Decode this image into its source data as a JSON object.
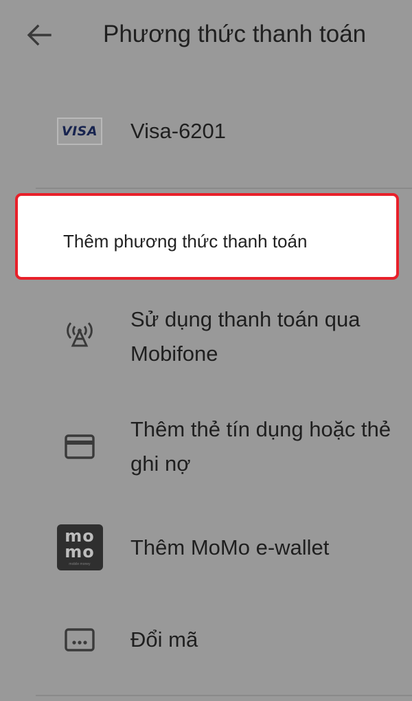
{
  "header": {
    "title": "Phương thức thanh toán",
    "back_icon": "arrow-left-icon"
  },
  "saved_method": {
    "brand_badge": "VISA",
    "label": "Visa-6201",
    "icon": "visa-icon"
  },
  "add_method": {
    "label": "Thêm phương thức thanh toán"
  },
  "options": [
    {
      "icon": "carrier-signal-icon",
      "label": "Sử dụng thanh toán qua Mobifone"
    },
    {
      "icon": "credit-card-icon",
      "label": "Thêm thẻ tín dụng hoặc thẻ ghi nợ"
    },
    {
      "icon": "momo-logo-icon",
      "logo_text": "mo\nmo",
      "logo_subtext": "mobile money",
      "label": "Thêm MoMo e-wallet"
    },
    {
      "icon": "redeem-code-icon",
      "label": "Đổi mã"
    }
  ],
  "colors": {
    "overlay_background": "#999999",
    "highlight_border": "#e8202a",
    "highlight_fill": "#ffffff"
  }
}
